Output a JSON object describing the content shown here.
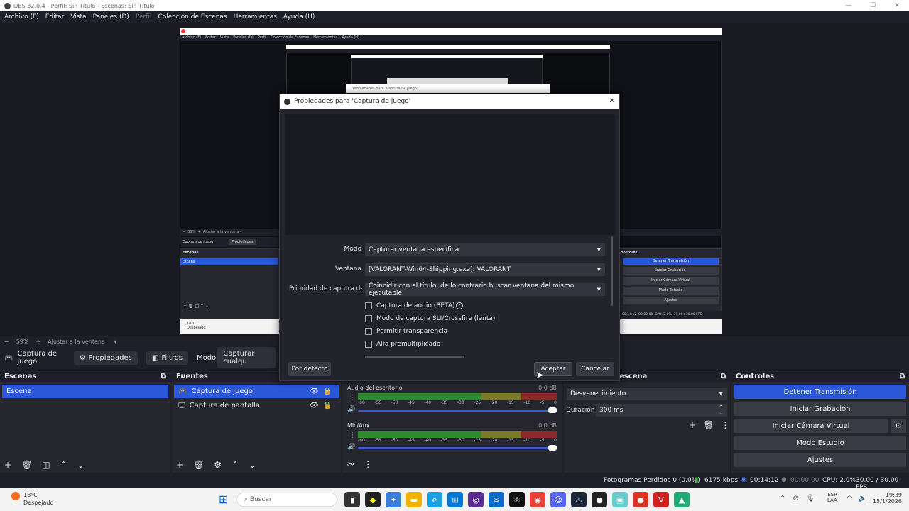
{
  "window": {
    "title": "OBS 32.0.4 - Perfil: Sin Título - Escenas: Sin Título"
  },
  "menu": [
    {
      "label": "Archivo (F)",
      "dim": false
    },
    {
      "label": "Editar",
      "dim": false
    },
    {
      "label": "Vista",
      "dim": false
    },
    {
      "label": "Paneles (D)",
      "dim": false
    },
    {
      "label": "Perfil",
      "dim": true
    },
    {
      "label": "Colección de Escenas",
      "dim": false
    },
    {
      "label": "Herramientas",
      "dim": false
    },
    {
      "label": "Ayuda (H)",
      "dim": false
    }
  ],
  "zoom": {
    "minus": "−",
    "percent": "59%",
    "plus": "+",
    "fit": "Ajustar a la ventana"
  },
  "source_bar": {
    "source": "Captura de juego",
    "properties": "Propiedades",
    "filters": "Filtros",
    "mode_label": "Modo",
    "mode_value": "Capturar cualqu"
  },
  "scenes": {
    "title": "Escenas",
    "items": [
      "Escena"
    ]
  },
  "sources": {
    "title": "Fuentes",
    "items": [
      "Captura de juego",
      "Captura de pantalla"
    ]
  },
  "mixer": {
    "channels": [
      {
        "name": "Audio del escritorio",
        "db": "0.0 dB"
      },
      {
        "name": "Mic/Aux",
        "db": "0.0 dB"
      }
    ],
    "ticks": [
      "-60",
      "-55",
      "-50",
      "-45",
      "-40",
      "-35",
      "-30",
      "-25",
      "-20",
      "-15",
      "-10",
      "-5",
      "0"
    ]
  },
  "transitions": {
    "title": "escena",
    "type": "Desvanecimiento",
    "duration_label": "Duración",
    "duration_value": "300 ms"
  },
  "controls": {
    "title": "Controles",
    "buttons": [
      "Detener Transmisión",
      "Iniciar Grabación",
      "Iniciar Cámara Virtual",
      "Modo Estudio",
      "Ajustes"
    ]
  },
  "status": {
    "dropped": "Fotogramas Perdidos 0 (0.0%)",
    "kbps": "6175 kbps",
    "stream_time": "00:14:12",
    "rec_time": "00:00:00",
    "cpu": "CPU: 2.0%",
    "fps": "30.00 / 30.00 FPS"
  },
  "dialog": {
    "title": "Propiedades para 'Captura de juego'",
    "close": "✕",
    "mode_label": "Modo",
    "mode_value": "Capturar ventana específica",
    "window_label": "Ventana",
    "window_value": "[VALORANT-Win64-Shipping.exe]: VALORANT",
    "priority_label": "Prioridad de captura de ve",
    "priority_value": "Coincidir con el título, de lo contrario buscar ventana del mismo ejecutable",
    "checks": [
      "Captura de audio (BETA)",
      "Modo de captura SLI/Crossfire (lenta)",
      "Permitir transparencia",
      "Alfa premultiplicado"
    ],
    "defaults": "Por defecto",
    "ok": "Aceptar",
    "cancel": "Cancelar"
  },
  "nested": {
    "menu": [
      "Archivo (F)",
      "Editar",
      "Vista",
      "Paneles (D)",
      "Perfil",
      "Colección de Escenas",
      "Herramientas",
      "Ayuda (H)"
    ],
    "scene_tab": "Captura de juego",
    "props": "Propiedades",
    "scenes": "Escenas",
    "scene_item": "Escena",
    "controls": "ontroles",
    "buttons": [
      "Detener Transmisión",
      "Iniciar Grabación",
      "Iniciar Cámara Virtual",
      "Modo Estudio",
      "Ajustes"
    ],
    "status_left": "00:14:12",
    "status_mid": "00:00:00",
    "status_cpu": "CPU: 2.0%",
    "status_fps": "30.00 / 30.00 FPS",
    "dialog_title": "Propiedades para 'Captura de juego'",
    "zoom": "59%",
    "fit": "Ajustar a la ventana",
    "taskbar_time": "00:14:12",
    "weather_small": "18°C",
    "weather_small2": "Despejado"
  },
  "taskbar": {
    "weather_temp": "18°C",
    "weather_desc": "Despejado",
    "search": "Buscar",
    "lang1": "ESP",
    "lang2": "LAA",
    "time": "19:39",
    "date": "15/1/2026"
  }
}
